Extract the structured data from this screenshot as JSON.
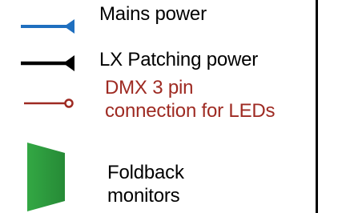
{
  "legend": {
    "items": [
      {
        "label": "Mains power",
        "icon": "blue-cable-arrow-icon",
        "color": "#1f6fbf"
      },
      {
        "label": "LX Patching power",
        "icon": "black-cable-arrow-icon",
        "color": "#000000"
      },
      {
        "label_lines": [
          "DMX 3 pin",
          "connection for LEDs"
        ],
        "icon": "red-cable-connector-icon",
        "color": "#9e2a22"
      },
      {
        "label_lines": [
          "Foldback",
          "monitors"
        ],
        "icon": "green-monitor-wedge-icon",
        "color": "#2f9a3c"
      }
    ],
    "divider_color": "#000000"
  }
}
